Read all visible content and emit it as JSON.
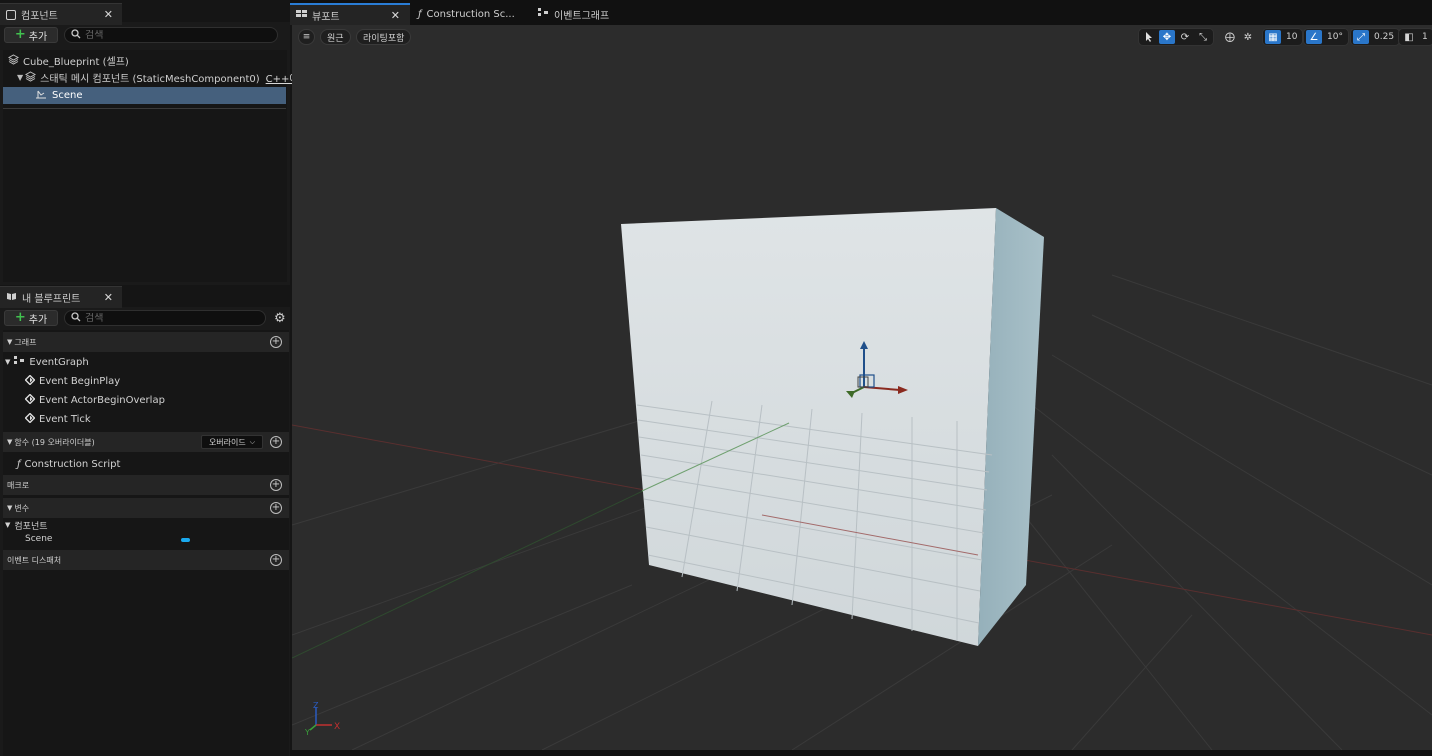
{
  "components_panel": {
    "tab_label": "컴포넌트",
    "add_label": "추가",
    "search_placeholder": "검색",
    "tree": [
      {
        "label": "Cube_Blueprint (셀프)"
      },
      {
        "label": "스태틱 메시 컴포넌트 (StaticMeshComponent0)",
        "badge": "C++에..."
      },
      {
        "label": "Scene"
      }
    ]
  },
  "my_blueprint_panel": {
    "tab_label": "내 블루프린트",
    "add_label": "추가",
    "search_placeholder": "검색",
    "sections": {
      "graphs": "그래프",
      "event_graph": "EventGraph",
      "events": [
        "Event BeginPlay",
        "Event ActorBeginOverlap",
        "Event Tick"
      ],
      "functions": "함수 (19 오버라이더블)",
      "override_label": "오버라이드",
      "construction_script": "Construction Script",
      "macros": "매크로",
      "variables": "변수",
      "components_group": "컴포넌트",
      "scene_var": "Scene",
      "event_dispatchers": "이벤트 디스패처"
    }
  },
  "editor_tabs": [
    {
      "label": "뷰포트"
    },
    {
      "label": "Construction Sc..."
    },
    {
      "label": "이벤트그래프"
    }
  ],
  "viewport": {
    "perspective_label": "원근",
    "lighting_label": "라이팅포함",
    "grid_snap": "10",
    "rotation_snap": "10°",
    "scale_snap": "0.25",
    "camera_speed": "1",
    "accent_color": "#2a76c9",
    "cube_color": "#d7dde0"
  }
}
